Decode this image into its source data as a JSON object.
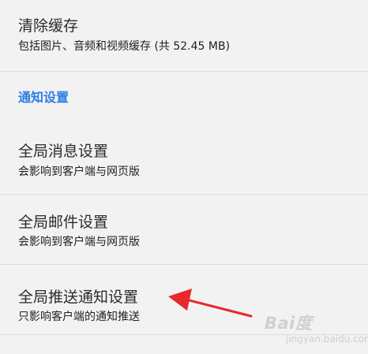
{
  "clear_cache": {
    "title": "清除缓存",
    "subtitle": "包括图片、音频和视频缓存 (共 52.45 MB)"
  },
  "notification_section": {
    "header": "通知设置"
  },
  "global_message": {
    "title": "全局消息设置",
    "subtitle": "会影响到客户端与网页版"
  },
  "global_mail": {
    "title": "全局邮件设置",
    "subtitle": "会影响到客户端与网页版"
  },
  "global_push": {
    "title": "全局推送通知设置",
    "subtitle": "只影响客户端的通知推送"
  },
  "watermark": {
    "brand": "Bai度",
    "url": "jingyan.baidu.com"
  },
  "colors": {
    "accent": "#2a7de6",
    "arrow": "#e8282b"
  }
}
